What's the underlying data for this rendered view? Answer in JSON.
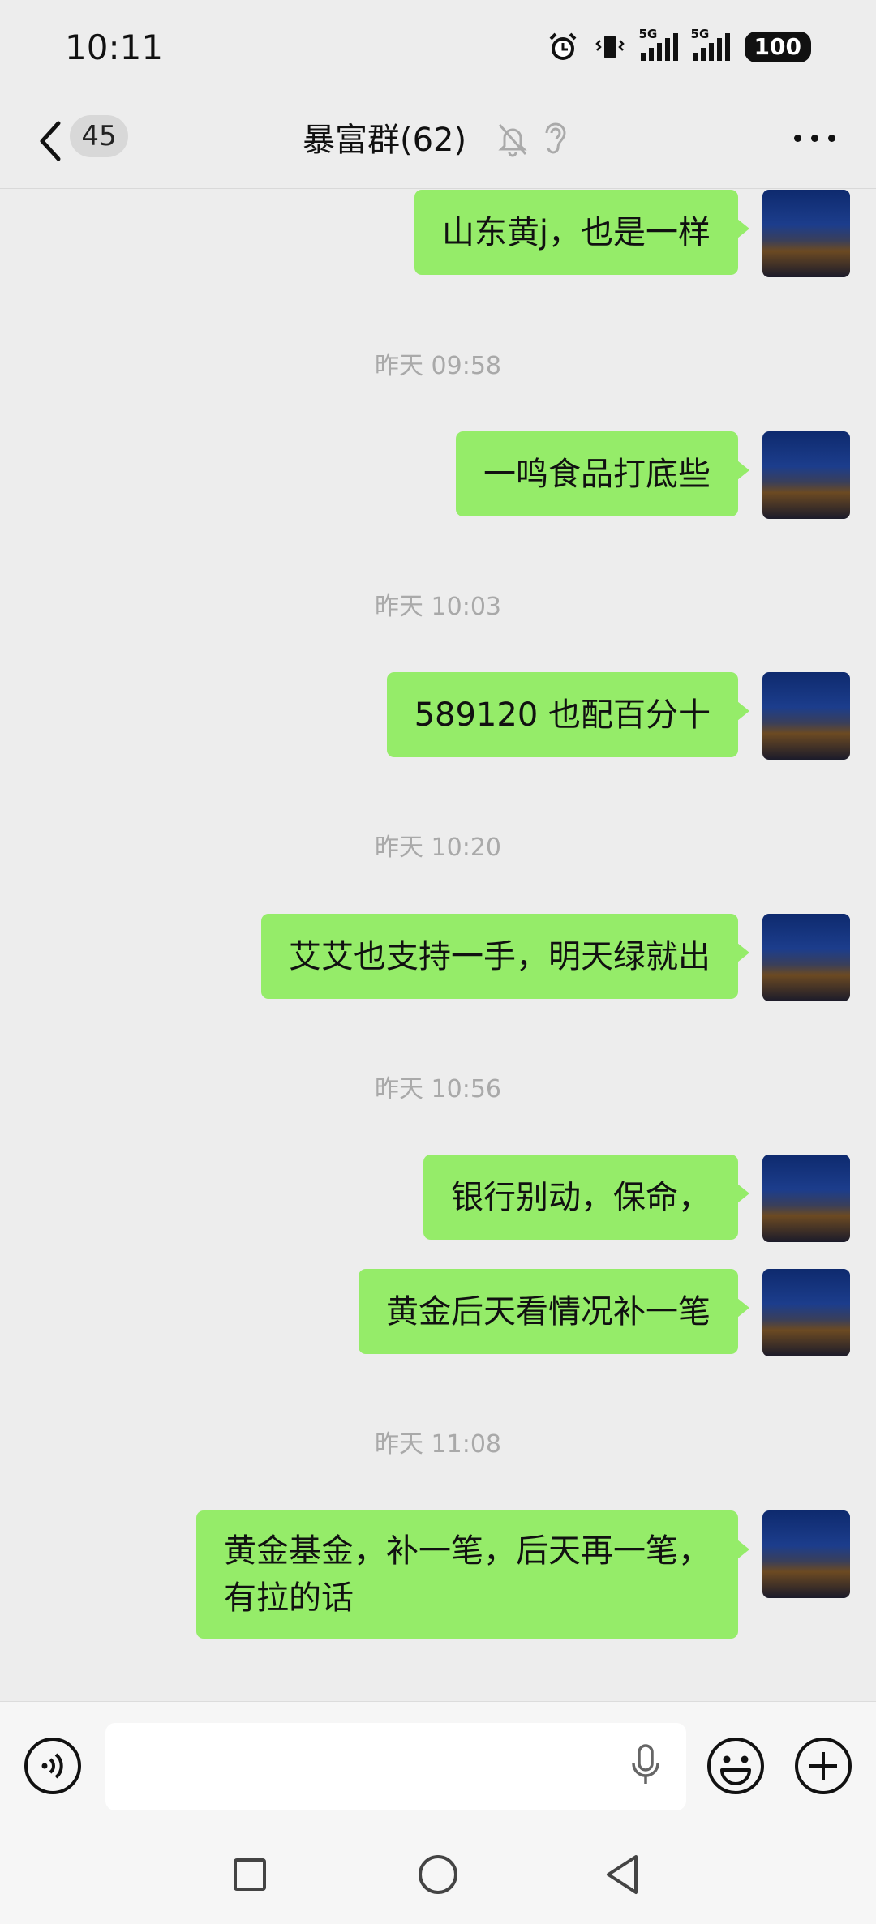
{
  "status_bar": {
    "time": "10:11",
    "network_1": "5G",
    "network_2": "5G",
    "battery": "100"
  },
  "header": {
    "back_count": "45",
    "title": "暴富群(62)"
  },
  "messages": [
    {
      "type": "outgoing",
      "text": "山东黄j，也是一样"
    },
    {
      "type": "time",
      "text": "昨天 09:58"
    },
    {
      "type": "outgoing",
      "text": "一鸣食品打底些"
    },
    {
      "type": "time",
      "text": "昨天 10:03"
    },
    {
      "type": "outgoing",
      "text": "589120 也配百分十"
    },
    {
      "type": "time",
      "text": "昨天 10:20"
    },
    {
      "type": "outgoing",
      "text": "艾艾也支持一手，明天绿就出"
    },
    {
      "type": "time",
      "text": "昨天 10:56"
    },
    {
      "type": "outgoing",
      "text": "银行别动，保命，"
    },
    {
      "type": "outgoing",
      "text": "黄金后天看情况补一笔"
    },
    {
      "type": "time",
      "text": "昨天 11:08"
    },
    {
      "type": "outgoing",
      "line1": "黄金基金，补一笔，后天再一笔，",
      "line2": "有拉的话"
    }
  ],
  "colors": {
    "outgoing_bubble": "#95ec69",
    "background": "#ededed"
  },
  "icons": [
    "alarm-icon",
    "vibrate-icon",
    "signal-icon",
    "battery-icon",
    "back-chevron-icon",
    "mute-icon",
    "ear-icon",
    "more-icon",
    "voice-icon",
    "mic-icon",
    "emoji-icon",
    "plus-icon",
    "recents-icon",
    "home-icon",
    "back-icon"
  ]
}
